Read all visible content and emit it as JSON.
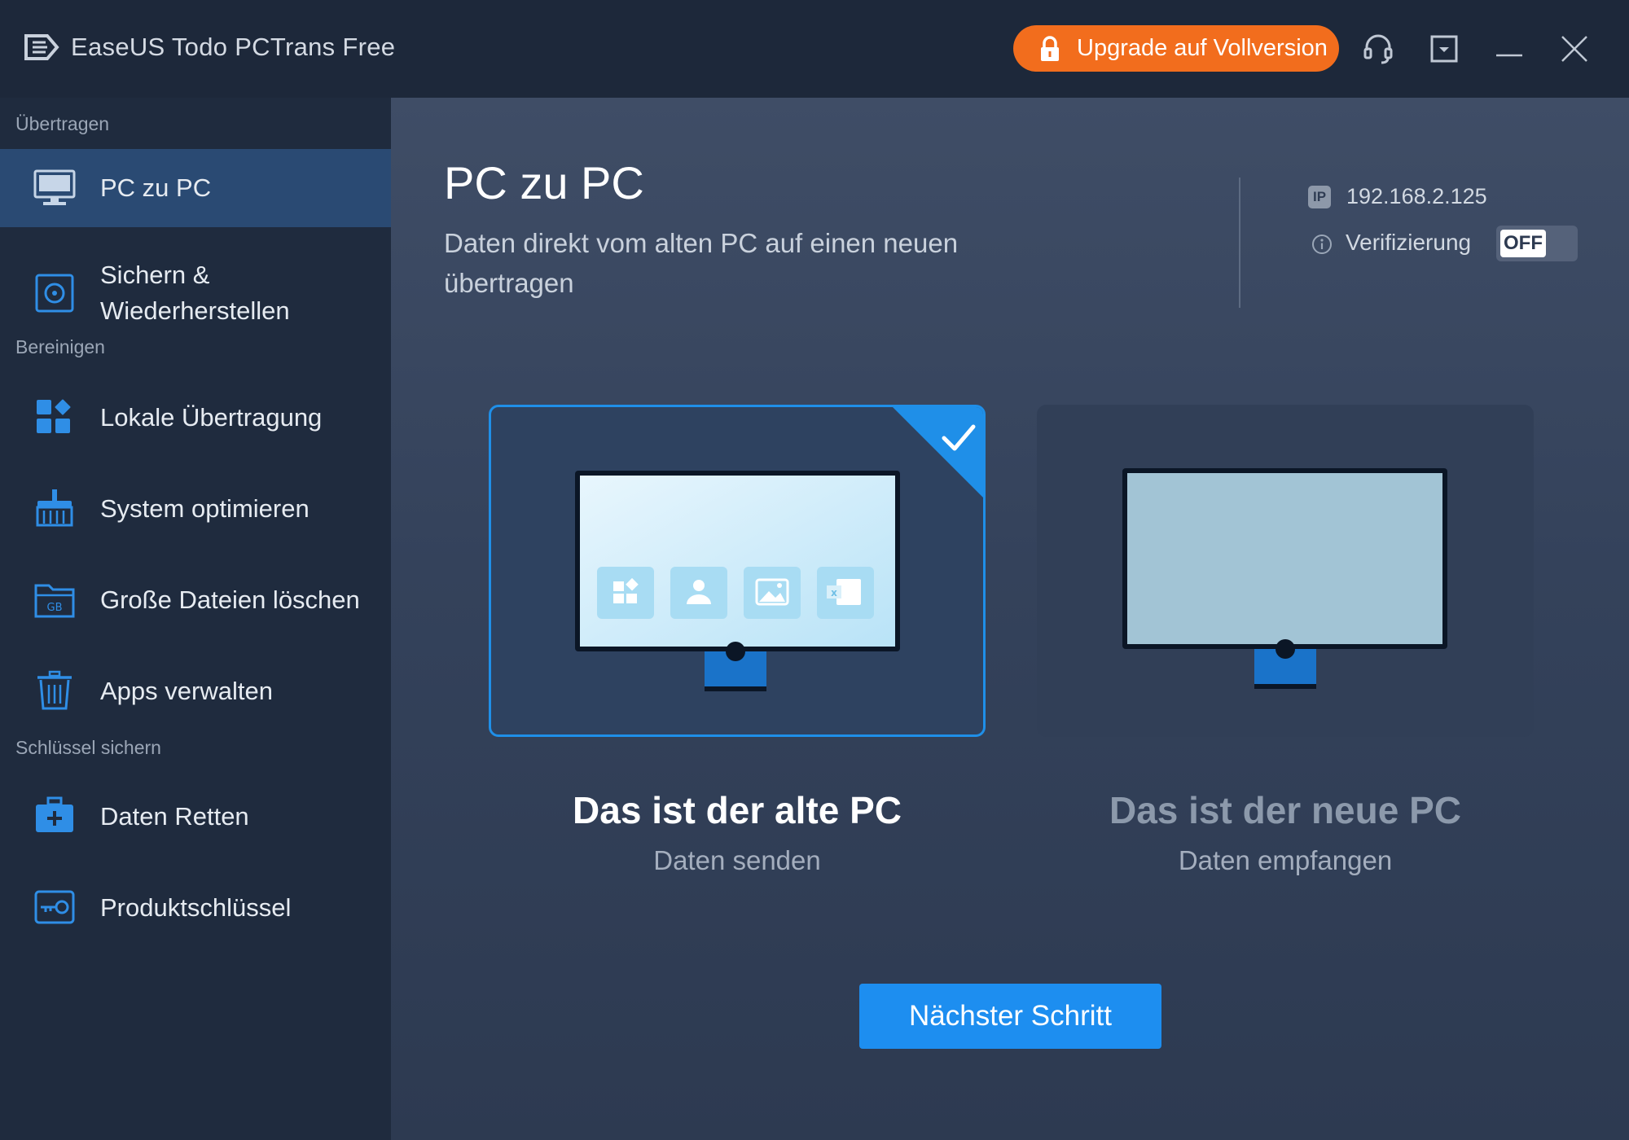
{
  "app": {
    "title": "EaseUS Todo PCTrans Free"
  },
  "titlebar": {
    "upgrade_label": "Upgrade auf Vollversion"
  },
  "sidebar": {
    "sections": [
      "Übertragen",
      "Bereinigen",
      "Schlüssel sichern"
    ],
    "items": [
      {
        "label": "PC zu PC",
        "icon": "monitor-icon",
        "active": true
      },
      {
        "label": "Sichern &\nWiederherstellen",
        "icon": "backup-disk-icon"
      },
      {
        "label": "Lokale Übertragung",
        "icon": "apps-grid-icon"
      },
      {
        "label": "System optimieren",
        "icon": "broom-icon"
      },
      {
        "label": "Große Dateien löschen",
        "icon": "gb-folder-icon"
      },
      {
        "label": "Apps verwalten",
        "icon": "trash-icon"
      },
      {
        "label": "Daten Retten",
        "icon": "medkit-icon"
      },
      {
        "label": "Produktschlüssel",
        "icon": "key-icon"
      }
    ]
  },
  "main": {
    "title": "PC zu PC",
    "subtitle": "Daten direkt vom alten PC auf einen neuen übertragen",
    "ip_badge": "IP",
    "ip": "192.168.2.125",
    "verification_label": "Verifizierung",
    "verification_state": "OFF",
    "cards": [
      {
        "title": "Das ist der alte PC",
        "subtitle": "Daten senden",
        "selected": true
      },
      {
        "title": "Das ist der neue PC",
        "subtitle": "Daten empfangen",
        "selected": false
      }
    ],
    "next_label": "Nächster Schritt"
  },
  "colors": {
    "accent": "#1d8ef0",
    "upgrade": "#f26d1d",
    "sidebar_active": "#2a4a73"
  }
}
